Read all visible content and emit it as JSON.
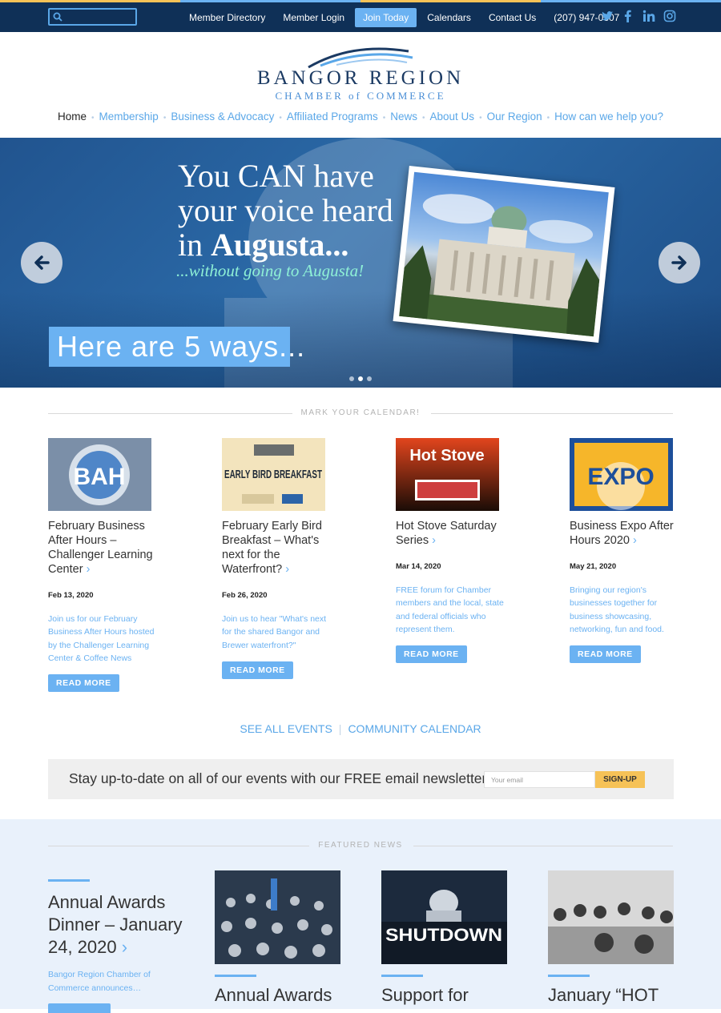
{
  "topbar": {
    "search_placeholder": "",
    "links": [
      "Member Directory",
      "Member Login",
      "Join Today",
      "Calendars",
      "Contact Us",
      "(207) 947-0307"
    ],
    "social": [
      "twitter-icon",
      "facebook-icon",
      "linkedin-icon",
      "instagram-icon"
    ]
  },
  "logo": {
    "name": "BANGOR REGION",
    "sub": "CHAMBER of COMMERCE"
  },
  "mainnav": [
    "Home",
    "Membership",
    "Business & Advocacy",
    "Affiliated Programs",
    "News",
    "About Us",
    "Our Region",
    "How can we help you?"
  ],
  "hero": {
    "line1": "You CAN have",
    "line2": "your voice heard",
    "line3a": "in ",
    "line3b": "Augusta...",
    "tagline": "...without going to Augusta!",
    "cta": "Here are 5 ways...",
    "slides": 3,
    "active_slide": 2
  },
  "calendar": {
    "heading": "MARK YOUR CALENDAR!",
    "events": [
      {
        "title": "February Business After Hours – Challenger Learning Center",
        "thumb_text": "BAH",
        "date": "Feb 13, 2020",
        "desc": "Join us for our February Business After Hours hosted by the Challenger Learning Center & Coffee News",
        "button": "READ MORE"
      },
      {
        "title": "February Early Bird Breakfast – What's next for the Waterfront?",
        "thumb_text": "EARLY BIRD BREAKFAST",
        "date": "Feb 26, 2020",
        "desc": "Join us to hear \"What's next for the shared Bangor and Brewer waterfront?\"",
        "button": "READ MORE"
      },
      {
        "title": "Hot Stove Saturday Series",
        "thumb_text": "Hot Stove",
        "date": "Mar 14, 2020",
        "desc": "FREE forum for Chamber members and the local, state and federal officials who represent them.",
        "button": "READ MORE"
      },
      {
        "title": "Business Expo After Hours 2020",
        "thumb_text": "EXPO",
        "date": "May 21, 2020",
        "desc": "Bringing our region's businesses together for business showcasing, networking, fun and food.",
        "button": "READ MORE"
      }
    ],
    "see_all": "SEE ALL EVENTS",
    "community": "COMMUNITY CALENDAR"
  },
  "newsletter": {
    "text": "Stay up-to-date on all of our events with our FREE email newsletter!",
    "placeholder": "Your email",
    "button": "SIGN-UP"
  },
  "featured": {
    "heading": "FEATURED NEWS",
    "lead_title": "Annual Awards Dinner – January 24, 2020",
    "lead_desc": "Bangor Region Chamber of Commerce announces…",
    "cards": [
      {
        "title": "Annual Awards",
        "img": "banquet"
      },
      {
        "title": "Support for",
        "img": "SHUTDOWN"
      },
      {
        "title": "January “HOT",
        "img": "meeting"
      }
    ]
  }
}
